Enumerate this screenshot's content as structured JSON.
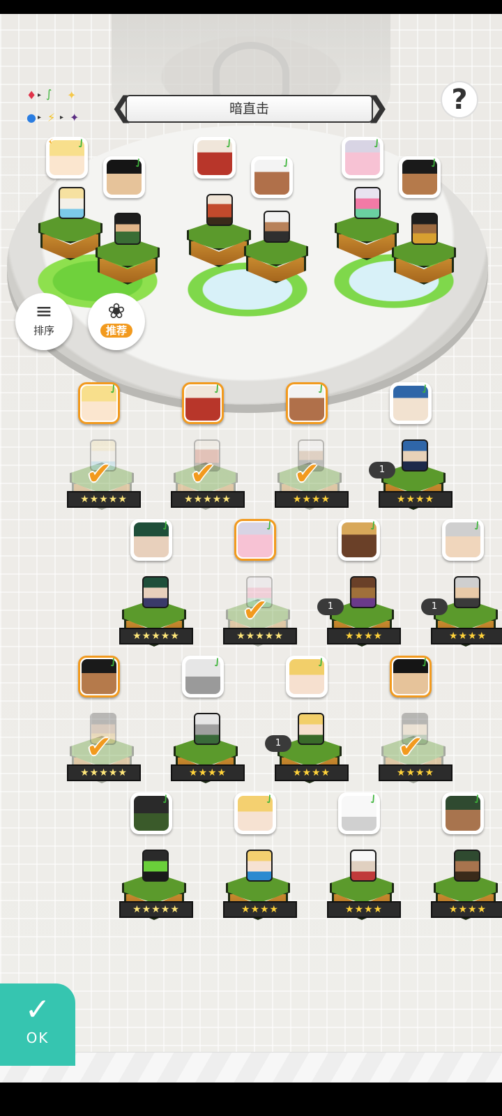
{
  "header": {
    "title": "暗直击",
    "prev_icon": "chevron-left",
    "next_icon": "chevron-right",
    "help_label": "?"
  },
  "element_chart": {
    "symbols": [
      "♦",
      "▸",
      "∫",
      "✦",
      "●",
      "▸",
      "⚡",
      "▸",
      "✦"
    ],
    "colors": [
      "#e0334a",
      "#333333",
      "#3db53a",
      "#f5c84b",
      "#2a7de1",
      "#333333",
      "#f5c320",
      "#333333",
      "#5a2d82"
    ]
  },
  "controls": {
    "sort_label": "排序",
    "recommend_label": "推荐",
    "ok_label": "OK"
  },
  "colors": {
    "accent_orange": "#f29a1e",
    "ok_teal": "#36c5b0",
    "grass_green": "#5b9a2c",
    "leaf_green": "#3db53a"
  },
  "roster": [
    {
      "row": 1,
      "stars": "★★★★★",
      "selected": true,
      "dupes": ""
    },
    {
      "row": 1,
      "stars": "★★★★★",
      "selected": true,
      "dupes": ""
    },
    {
      "row": 1,
      "stars": "★★★★",
      "selected": true,
      "dupes": ""
    },
    {
      "row": 1,
      "stars": "★★★★",
      "selected": false,
      "dupes": "1"
    },
    {
      "row": 2,
      "stars": "★★★★★",
      "selected": false,
      "dupes": ""
    },
    {
      "row": 2,
      "stars": "★★★★★",
      "selected": true,
      "dupes": ""
    },
    {
      "row": 2,
      "stars": "★★★★",
      "selected": false,
      "dupes": "1"
    },
    {
      "row": 2,
      "stars": "★★★★",
      "selected": false,
      "dupes": "1"
    },
    {
      "row": 3,
      "stars": "★★★★★",
      "selected": true,
      "dupes": ""
    },
    {
      "row": 3,
      "stars": "★★★★",
      "selected": false,
      "dupes": ""
    },
    {
      "row": 3,
      "stars": "★★★★",
      "selected": false,
      "dupes": "1"
    },
    {
      "row": 3,
      "stars": "★★★★",
      "selected": true,
      "dupes": ""
    },
    {
      "row": 4,
      "stars": "★★★★★",
      "selected": false,
      "dupes": ""
    },
    {
      "row": 4,
      "stars": "★★★★",
      "selected": false,
      "dupes": ""
    },
    {
      "row": 4,
      "stars": "★★★★",
      "selected": false,
      "dupes": ""
    },
    {
      "row": 4,
      "stars": "★★★★",
      "selected": false,
      "dupes": ""
    }
  ]
}
